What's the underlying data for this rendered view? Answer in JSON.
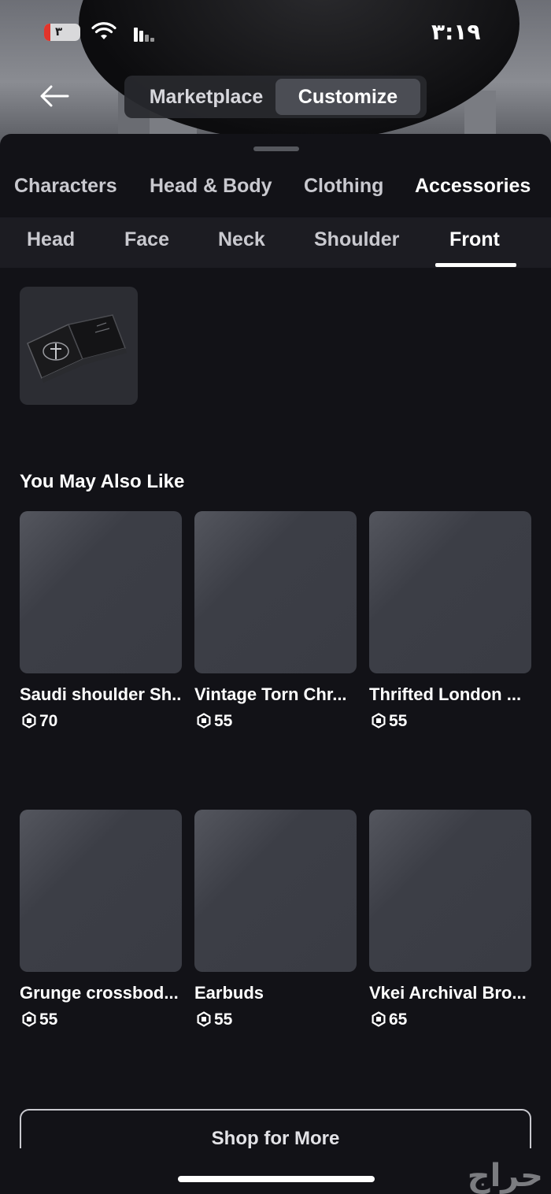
{
  "status_bar": {
    "time": "٣:١٩",
    "battery_level": "٣"
  },
  "header": {
    "segments": [
      {
        "label": "Marketplace",
        "selected": false
      },
      {
        "label": "Customize",
        "selected": true
      }
    ]
  },
  "category_tabs": [
    "Characters",
    "Head & Body",
    "Clothing",
    "Accessories"
  ],
  "category_active": "Accessories",
  "sub_tabs": [
    "Head",
    "Face",
    "Neck",
    "Shoulder",
    "Front"
  ],
  "sub_active": "Front",
  "recommendations": {
    "title": "You May Also Like",
    "items": [
      {
        "name": "Saudi shoulder Sh...",
        "price": "70"
      },
      {
        "name": "Vintage Torn Chr...",
        "price": "55"
      },
      {
        "name": "Thrifted London ...",
        "price": "55"
      },
      {
        "name": "Grunge crossbod...",
        "price": "55"
      },
      {
        "name": "Earbuds",
        "price": "55"
      },
      {
        "name": "Vkei Archival Bro...",
        "price": "65"
      }
    ]
  },
  "shop_button": "Shop for More",
  "watermark": "حراج",
  "icons": {
    "back": "arrow-left-icon",
    "currency": "robux-icon",
    "wifi": "wifi-icon",
    "signal": "cellular-signal-icon"
  }
}
